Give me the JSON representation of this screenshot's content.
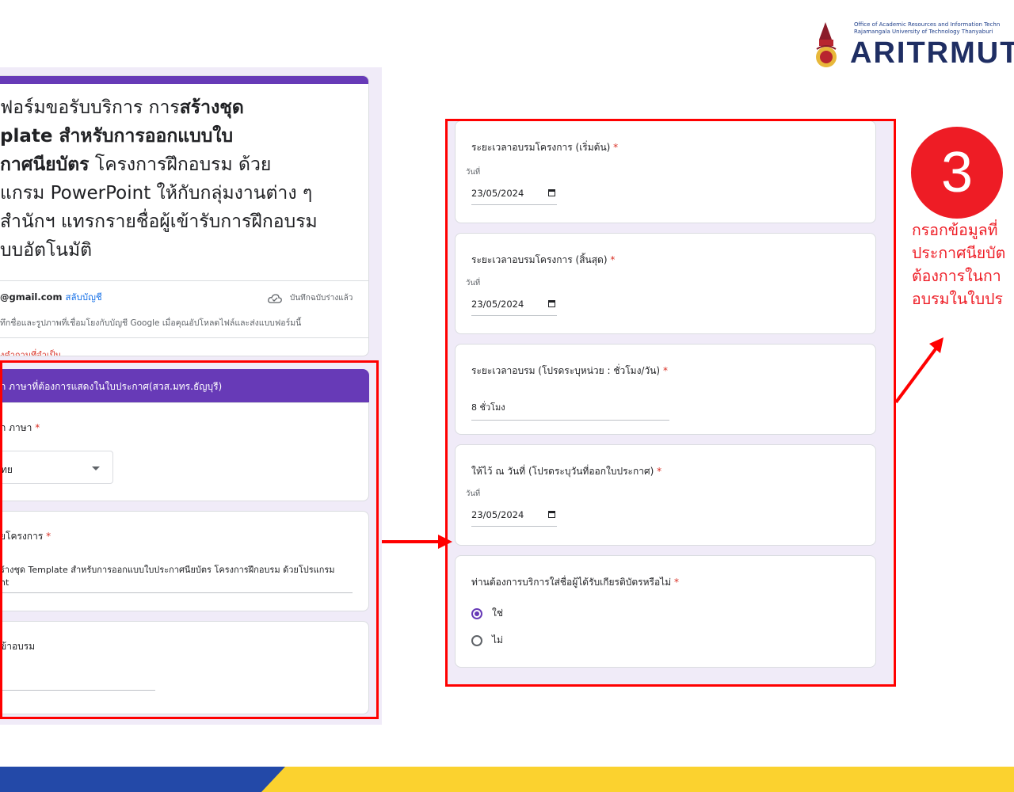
{
  "logo": {
    "office_line": "Office of Academic Resources and Information Techn",
    "university_line": "Rajamangala University of Technology Thanyaburi",
    "name": "ARITRMUTT"
  },
  "left_form": {
    "title_parts": [
      "ฟอร์มขอรับบริการ การ",
      "สร้างชุด\nplate สำหรับการออกแบบใบ\nกาศนียบัตร",
      " โครงการฝึกอบรม ด้วย\nแกรม PowerPoint ให้กับกลุ่มงานต่าง ๆ\nสำนักฯ แทรกรายชื่อผู้เข้ารับการฝึกอบรม\nบบอัตโนมัติ"
    ],
    "email": "@gmail.com",
    "switch_account": "สลับบัญชี",
    "saved_status": "บันทึกฉบับร่างแล้ว",
    "notice": "ทึกชื่อและรูปภาพที่เชื่อมโยงกับบัญชี Google เมื่อคุณอัปโหลดไฟล์และส่งแบบฟอร์มนี้",
    "required_note": "งคำถามที่จำเป็น",
    "section_title": "ก ภาษาที่ต้องการแสดงในใบประกาศ(สวส.มทร.ธัญบุรี)",
    "language_question": "ก ภาษา",
    "language_value": "ทย",
    "project_question": "ยโครงการ",
    "project_answer": "ร้างชุด Template สำหรับการออกแบบใบประกาศนียบัตร โครงการฝึกอบรม ด้วยโปรแกรม\nnt",
    "attendee_question": "ข้าอบรม"
  },
  "right_form": {
    "start_question": "ระยะเวลาอบรมโครงการ (เริ่มต้น)",
    "start_date_label": "วันที่",
    "start_date": "23/05/2024",
    "end_question": "ระยะเวลาอบรมโครงการ (สิ้นสุด)",
    "end_date_label": "วันที่",
    "end_date": "23/05/2024",
    "duration_question": "ระยะเวลาอบรม (โปรดระบุหน่วย : ชั่วโมง/วัน)",
    "duration_answer": "8 ชั่วโมง",
    "issue_question": "ให้ไว้ ณ วันที่ (โปรดระบุวันที่ออกใบประกาศ)",
    "issue_date_label": "วันที่",
    "issue_date": "23/05/2024",
    "names_question": "ท่านต้องการบริการใส่ชื่อผู้ได้รับเกียรติบัตรหรือไม่",
    "option_yes": "ใช่",
    "option_no": "ไม่",
    "required_mark": "*"
  },
  "step": {
    "number": "3",
    "text": "กรอกข้อมูลที่\nประกาศนียบัต\nต้องการในกา\nอบรมในใบปร"
  },
  "colors": {
    "highlight_red": "#ff0000",
    "step_red": "#ee1c25",
    "form_purple": "#673ab7",
    "footer_blue": "#2349a8",
    "footer_yellow": "#fbd22f"
  }
}
